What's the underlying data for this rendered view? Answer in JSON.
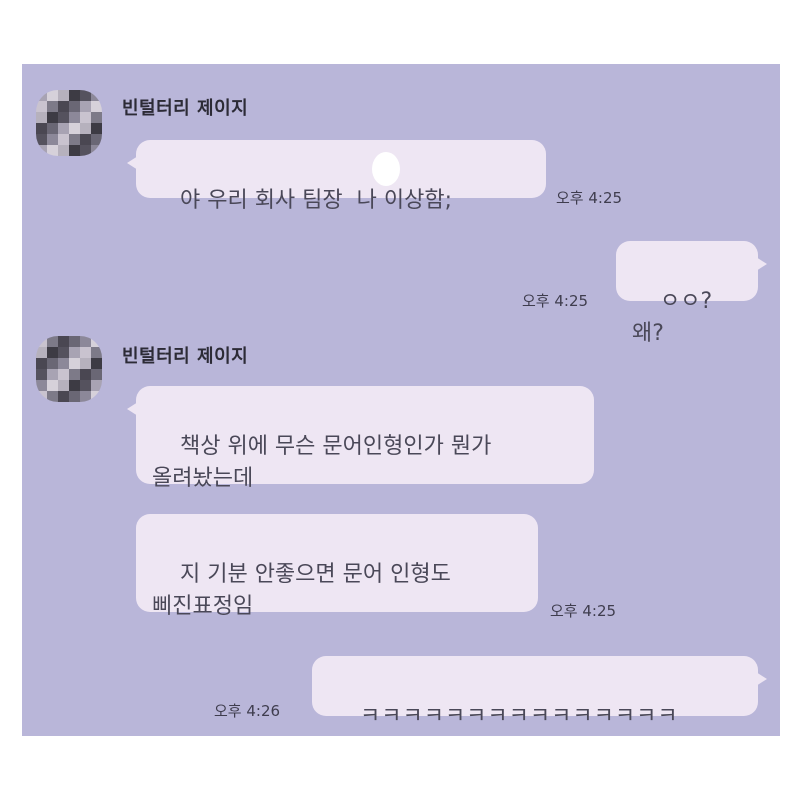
{
  "messages": [
    {
      "sender": "빈털터리 제이지",
      "text": "야 우리 회사 팀장  나 이상함;",
      "time": "오후 4:25"
    },
    {
      "sender": "me",
      "text": "ㅇㅇ?왜?",
      "time": "오후 4:25"
    },
    {
      "sender": "빈털터리 제이지",
      "text": "책상 위에 무슨 문어인형인가 뭔가\n올려놨는데"
    },
    {
      "sender": "빈털터리 제이지",
      "text": "지 기분 안좋으면 문어 인형도\n삐진표정임",
      "time": "오후 4:25"
    },
    {
      "sender": "me",
      "text": "ㅋㅋㅋㅋㅋㅋㅋㅋㅋㅋㅋㅋㅋㅋㅋ",
      "time": "오후 4:26"
    }
  ],
  "colors": {
    "chat_background": "#b9b6d9",
    "bubble": "#eee6f3",
    "text": "#4a4858"
  },
  "icons": {
    "avatar": "pixelated-profile-avatar-icon"
  }
}
